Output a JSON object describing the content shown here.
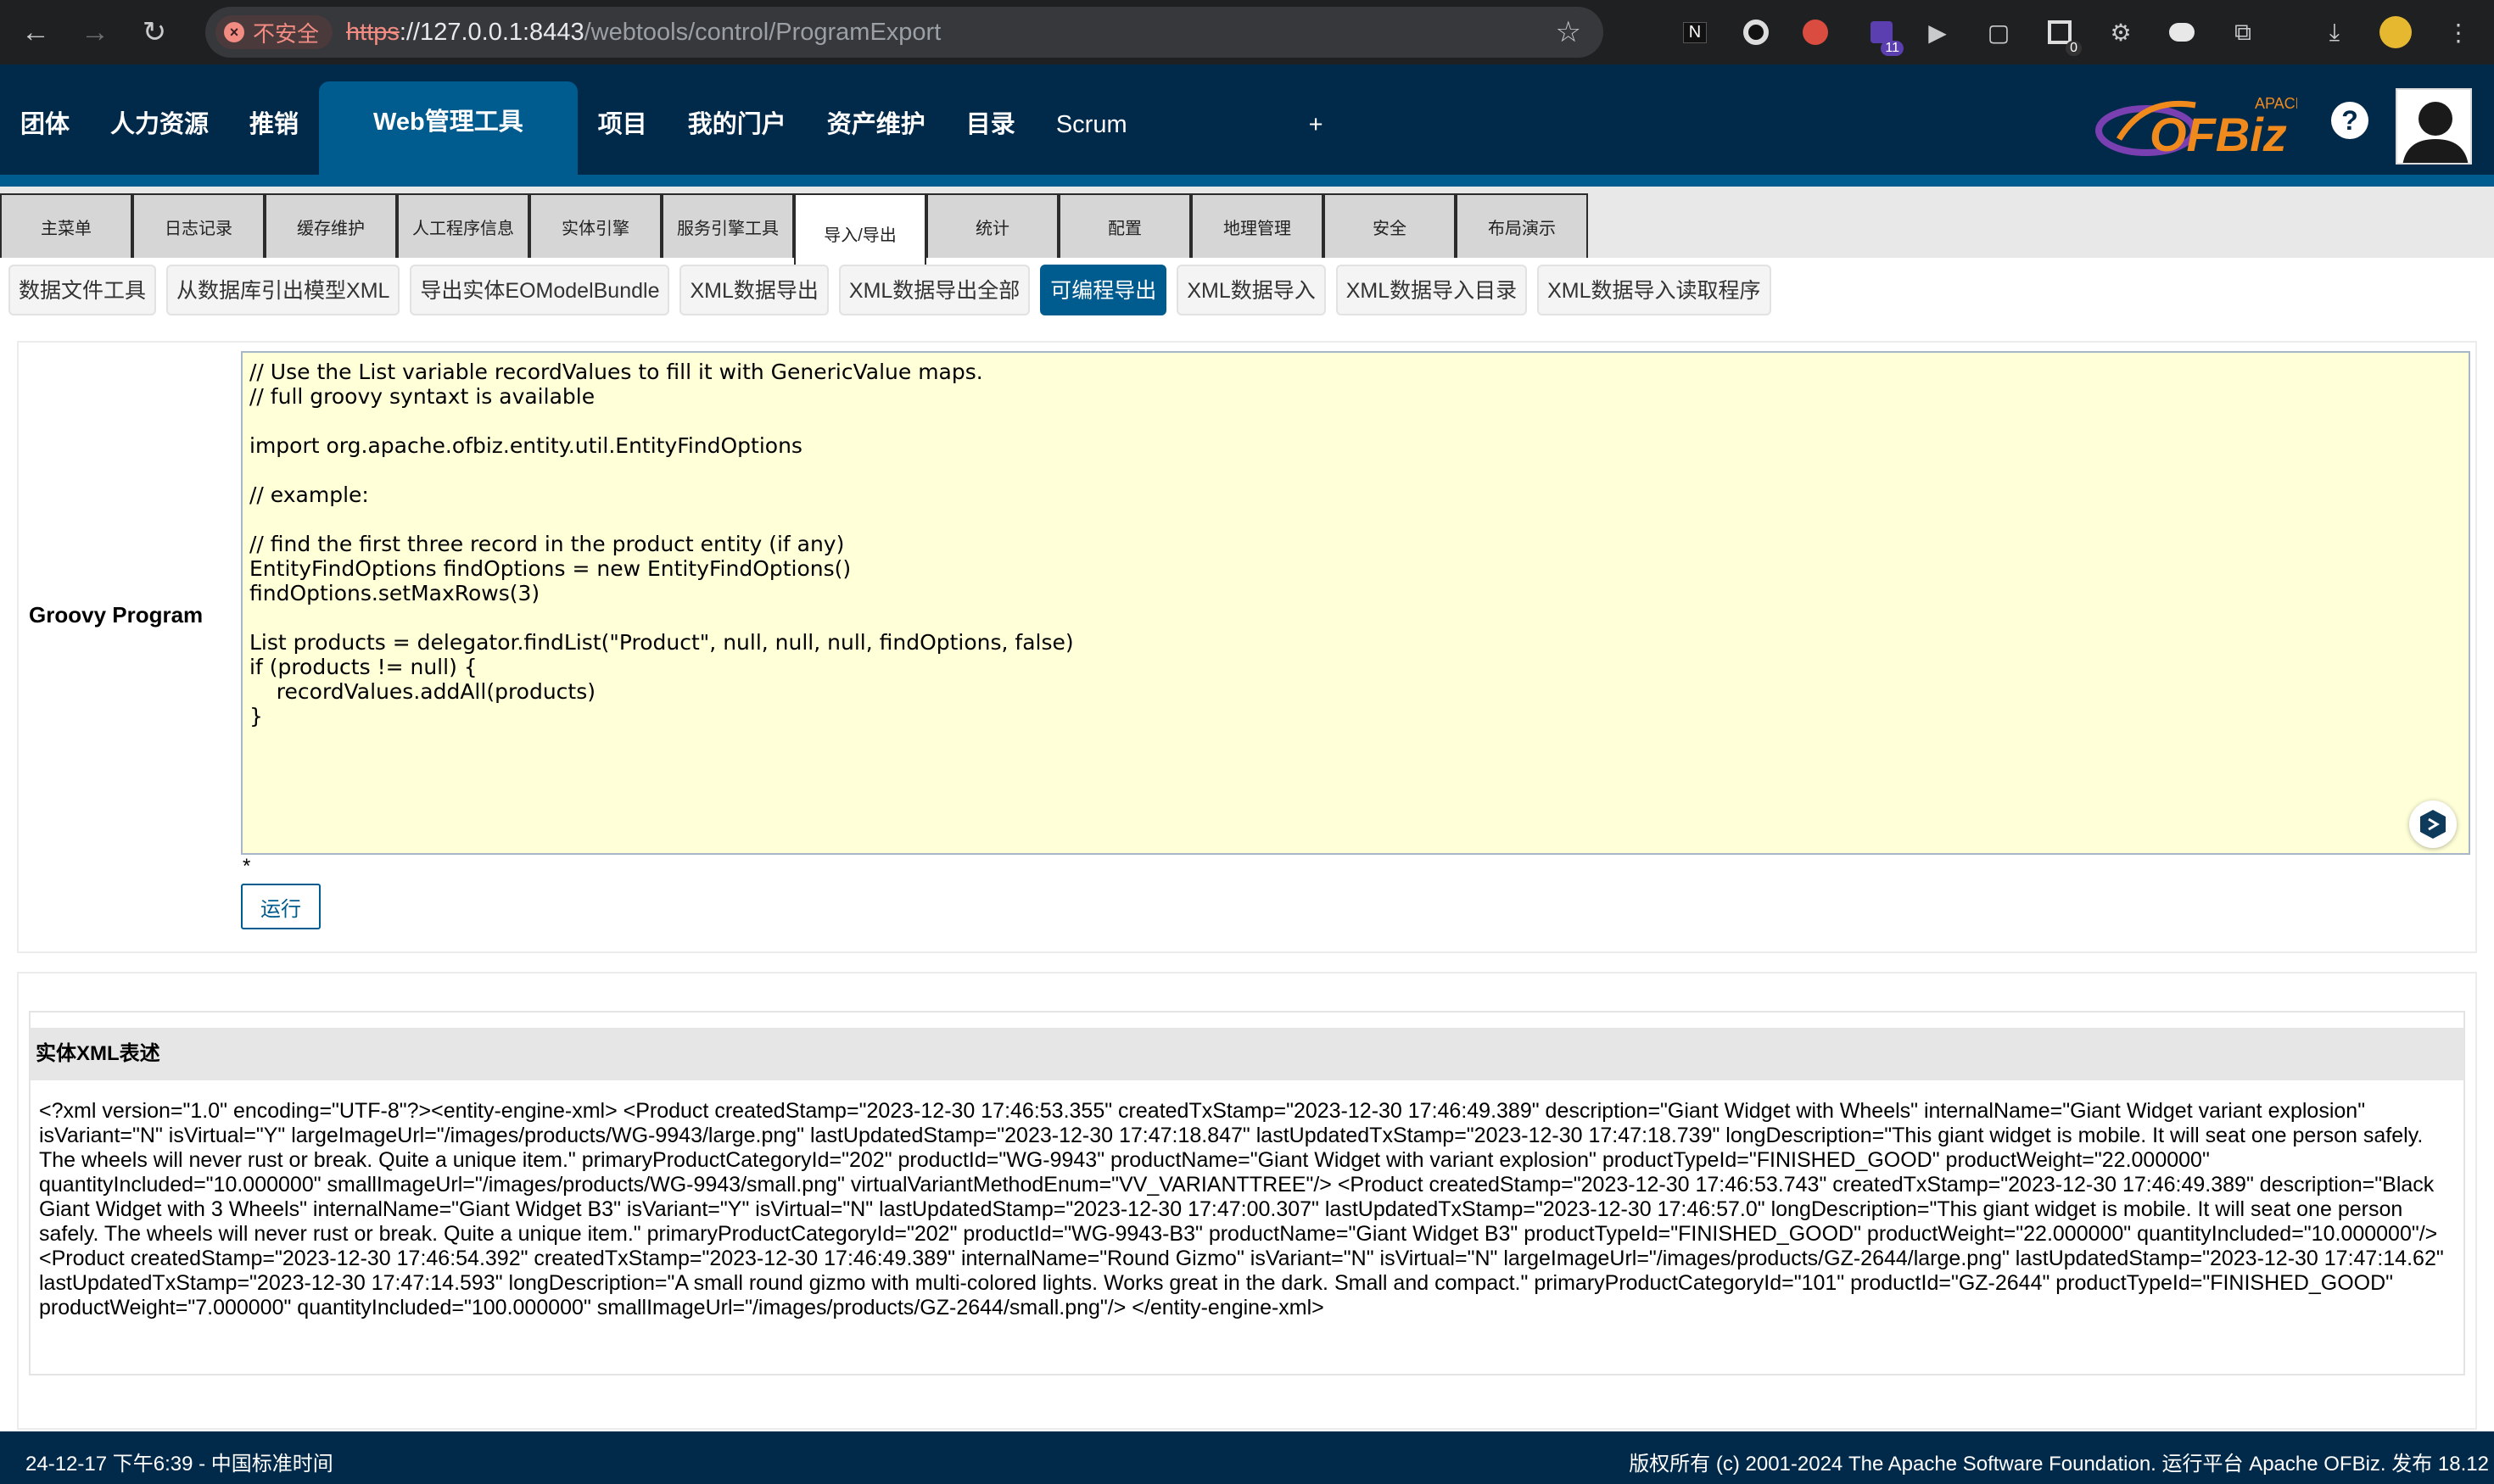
{
  "browser": {
    "insecure_label": "不安全",
    "url_scheme": "https",
    "url_host": "://127.0.0.1:8443",
    "url_path": "/webtools/control/ProgramExport",
    "extension_badge_1": "11",
    "extension_badge_2": "0"
  },
  "main_nav": {
    "items": [
      "团体",
      "人力资源",
      "推销",
      "Web管理工具",
      "项目",
      "我的门户",
      "资产维护",
      "目录",
      "Scrum",
      "+"
    ],
    "active": "Web管理工具"
  },
  "logo": {
    "super": "APACHE",
    "text": "OFBiz"
  },
  "sub_tabs": [
    "主菜单",
    "日志记录",
    "缓存维护",
    "人工程序信息",
    "实体引擎",
    "服务引擎工具",
    "导入/导出",
    "统计",
    "配置",
    "地理管理",
    "安全",
    "布局演示"
  ],
  "active_sub_tab": "导入/导出",
  "section_buttons": [
    "数据文件工具",
    "从数据库引出模型XML",
    "导出实体EOModelBundle",
    "XML数据导出",
    "XML数据导出全部",
    "可编程导出",
    "XML数据导入",
    "XML数据导入目录",
    "XML数据导入读取程序"
  ],
  "active_section_button": "可编程导出",
  "form": {
    "label": "Groovy Program",
    "program": "// Use the List variable recordValues to fill it with GenericValue maps.\n// full groovy syntaxt is available\n\nimport org.apache.ofbiz.entity.util.EntityFindOptions\n\n// example:\n\n// find the first three record in the product entity (if any)\nEntityFindOptions findOptions = new EntityFindOptions()\nfindOptions.setMaxRows(3)\n\nList products = delegator.findList(\"Product\", null, null, null, findOptions, false)\nif (products != null) {\n    recordValues.addAll(products)\n}",
    "required_mark": "*",
    "run_label": "运行"
  },
  "result": {
    "title": "实体XML表述",
    "xml": "<?xml version=\"1.0\" encoding=\"UTF-8\"?><entity-engine-xml>     <Product createdStamp=\"2023-12-30 17:46:53.355\" createdTxStamp=\"2023-12-30 17:46:49.389\" description=\"Giant Widget with Wheels\" internalName=\"Giant Widget variant explosion\" isVariant=\"N\" isVirtual=\"Y\" largeImageUrl=\"/images/products/WG-9943/large.png\" lastUpdatedStamp=\"2023-12-30 17:47:18.847\" lastUpdatedTxStamp=\"2023-12-30 17:47:18.739\" longDescription=\"This giant widget is mobile. It will seat one person safely. The wheels will never rust or break. Quite a unique item.\" primaryProductCategoryId=\"202\" productId=\"WG-9943\" productName=\"Giant Widget with variant explosion\" productTypeId=\"FINISHED_GOOD\" productWeight=\"22.000000\" quantityIncluded=\"10.000000\" smallImageUrl=\"/images/products/WG-9943/small.png\" virtualVariantMethodEnum=\"VV_VARIANTTREE\"/>      <Product createdStamp=\"2023-12-30 17:46:53.743\" createdTxStamp=\"2023-12-30 17:46:49.389\" description=\"Black Giant Widget with 3 Wheels\" internalName=\"Giant Widget B3\" isVariant=\"Y\" isVirtual=\"N\" lastUpdatedStamp=\"2023-12-30 17:47:00.307\" lastUpdatedTxStamp=\"2023-12-30 17:46:57.0\" longDescription=\"This giant widget is mobile. It will seat one person safely. The wheels will never rust or break. Quite a unique item.\" primaryProductCategoryId=\"202\" productId=\"WG-9943-B3\" productName=\"Giant Widget B3\" productTypeId=\"FINISHED_GOOD\" productWeight=\"22.000000\" quantityIncluded=\"10.000000\"/>      <Product createdStamp=\"2023-12-30 17:46:54.392\" createdTxStamp=\"2023-12-30 17:46:49.389\" internalName=\"Round Gizmo\" isVariant=\"N\" isVirtual=\"N\" largeImageUrl=\"/images/products/GZ-2644/large.png\" lastUpdatedStamp=\"2023-12-30 17:47:14.62\" lastUpdatedTxStamp=\"2023-12-30 17:47:14.593\" longDescription=\"A small round gizmo with multi-colored lights. Works great in the dark. Small and compact.\" primaryProductCategoryId=\"101\" productId=\"GZ-2644\" productTypeId=\"FINISHED_GOOD\" productWeight=\"7.000000\" quantityIncluded=\"100.000000\" smallImageUrl=\"/images/products/GZ-2644/small.png\"/> </entity-engine-xml>"
  },
  "footer": {
    "left": "24-12-17 下午6:39 - 中国标准时间",
    "right": "版权所有 (c) 2001-2024 The Apache Software Foundation. 运行平台 Apache OFBiz. 发布 18.12"
  },
  "colors": {
    "header_bg": "#012a4a",
    "accent": "#005b8e",
    "textarea_bg": "#ffffd8"
  }
}
